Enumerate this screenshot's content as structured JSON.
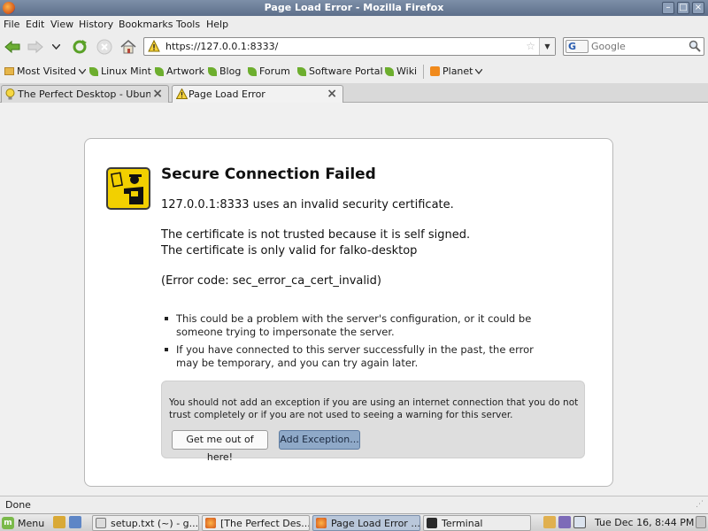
{
  "window": {
    "title": "Page Load Error - Mozilla Firefox"
  },
  "menubar": {
    "items": [
      "File",
      "Edit",
      "View",
      "History",
      "Bookmarks",
      "Tools",
      "Help"
    ]
  },
  "nav": {
    "url": "https://127.0.0.1:8333/",
    "search_placeholder": "Google",
    "search_engine_label": "G"
  },
  "bookmarks": {
    "most_visited": "Most Visited",
    "items": [
      "Linux Mint",
      "Artwork",
      "Blog",
      "Forum",
      "Software Portal",
      "Wiki"
    ],
    "planet": "Planet"
  },
  "tabs": [
    {
      "label": "The Perfect Desktop - Ubun...",
      "active": false
    },
    {
      "label": "Page Load Error",
      "active": true
    }
  ],
  "error": {
    "title": "Secure Connection Failed",
    "line1": "127.0.0.1:8333 uses an invalid security certificate.",
    "line2": "The certificate is not trusted because it is self signed.",
    "line3": "The certificate is only valid for falko-desktop",
    "code": "(Error code: sec_error_ca_cert_invalid)",
    "bullets": [
      [
        "This could be a problem with the server's configuration, or it could be",
        "someone trying to impersonate the server."
      ],
      [
        "If you have connected to this server successfully in the past, the error",
        "may be temporary, and you can try again later."
      ]
    ],
    "advice": "You should not add an exception if you are using an internet connection that you do not trust completely or if you are not used to seeing a warning for this server.",
    "btn_escape": "Get me out of here!",
    "btn_exception": "Add Exception..."
  },
  "status": {
    "text": "Done"
  },
  "taskbar": {
    "menu_label": "Menu",
    "windows": [
      "setup.txt (~) - g...",
      "[The Perfect Des...",
      "Page Load Error ...",
      "Terminal"
    ],
    "clock": "Tue Dec 16,  8:44 PM"
  },
  "colors": {
    "accent": "#8fa9c8",
    "titlebar": "#6b7d98",
    "warning_yellow": "#f2d000"
  }
}
